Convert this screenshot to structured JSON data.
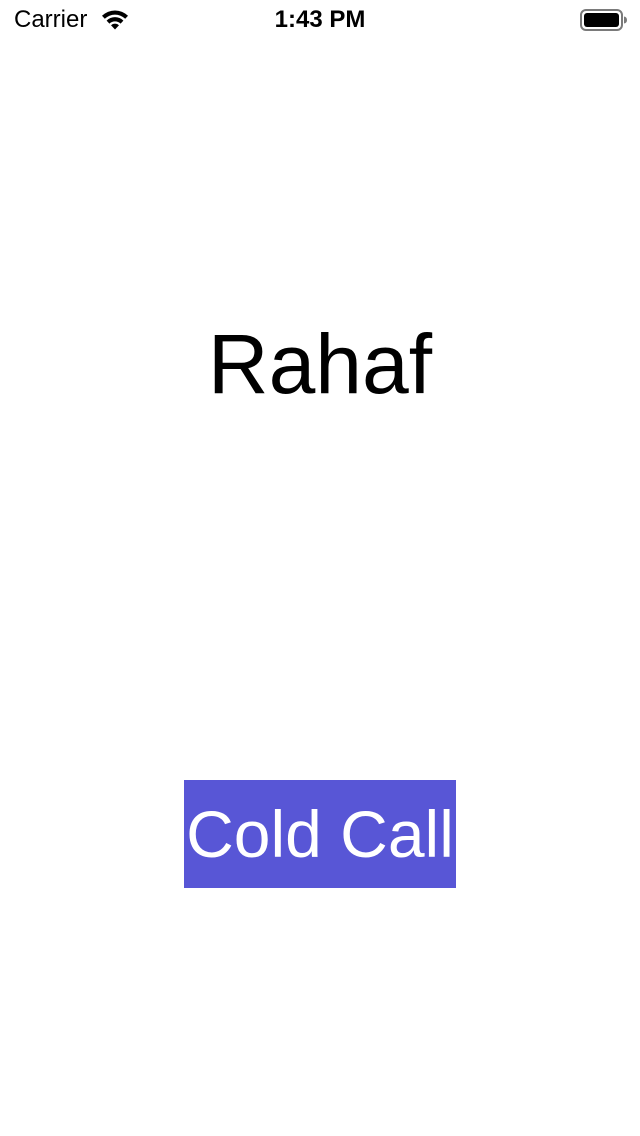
{
  "status_bar": {
    "carrier": "Carrier",
    "time": "1:43 PM",
    "wifi_icon": "wifi-icon",
    "battery_icon": "battery-icon"
  },
  "main": {
    "name": "Rahaf",
    "button_label": "Cold Call"
  },
  "colors": {
    "accent": "#5856d6",
    "background": "#ffffff",
    "text": "#000000",
    "button_text": "#ffffff"
  }
}
